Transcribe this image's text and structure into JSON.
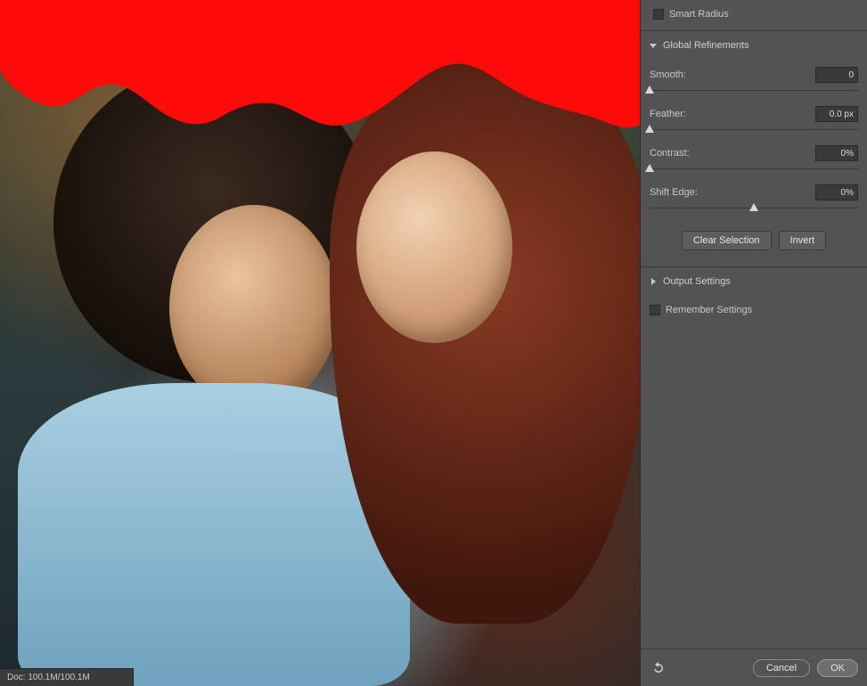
{
  "status_bar": {
    "doc_info": "Doc: 100.1M/100.1M"
  },
  "panel": {
    "edge_detection": {
      "smart_radius_label": "Smart Radius"
    },
    "global_refinements": {
      "title": "Global Refinements",
      "sliders": {
        "smooth": {
          "label": "Smooth:",
          "value": "0",
          "pos": 0
        },
        "feather": {
          "label": "Feather:",
          "value": "0.0 px",
          "pos": 0
        },
        "contrast": {
          "label": "Contrast:",
          "value": "0%",
          "pos": 0
        },
        "shift_edge": {
          "label": "Shift Edge:",
          "value": "0%",
          "pos": 50
        }
      },
      "clear_selection_label": "Clear Selection",
      "invert_label": "Invert"
    },
    "output_settings": {
      "title": "Output Settings"
    },
    "remember_settings_label": "Remember Settings",
    "footer": {
      "cancel_label": "Cancel",
      "ok_label": "OK"
    }
  },
  "mask_color": "#ff0a0a"
}
